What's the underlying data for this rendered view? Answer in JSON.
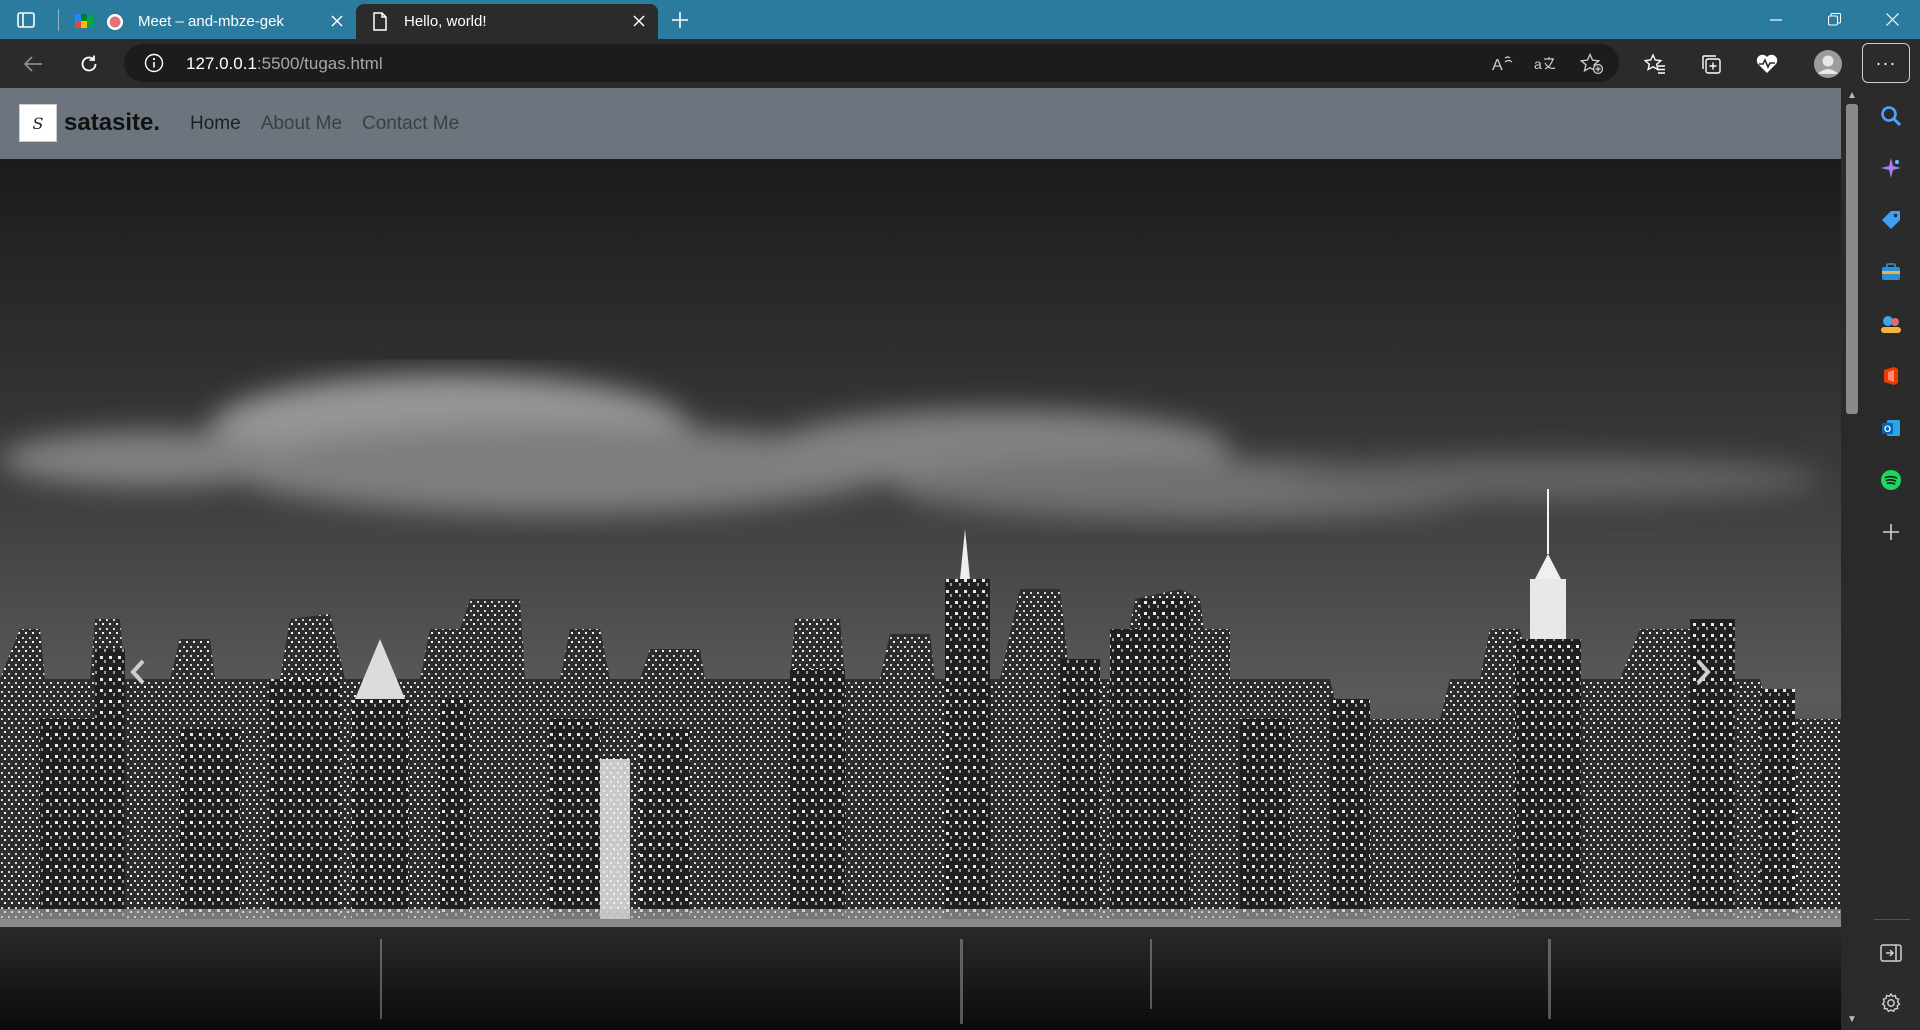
{
  "browser": {
    "tabs": [
      {
        "title": "Meet – and-mbze-gek",
        "active": false
      },
      {
        "title": "Hello, world!",
        "active": true
      }
    ],
    "url_host": "127.0.0.1",
    "url_rest": ":5500/tugas.html",
    "menu_label": "···"
  },
  "site": {
    "brand_mark": "S",
    "brand_name": "satasite.",
    "nav": [
      {
        "label": "Home",
        "active": true
      },
      {
        "label": "About Me",
        "active": false
      },
      {
        "label": "Contact Me",
        "active": false
      }
    ]
  },
  "hero": {
    "description": "",
    "colors": {
      "sky_top": "#1b1b1b",
      "sky_mid": "#5a5a5a",
      "water": "#0c0c0c"
    }
  },
  "icons": {
    "sidebar": [
      "search-icon",
      "copilot-icon",
      "shopping-tag-icon",
      "tools-icon",
      "games-icon",
      "office-icon",
      "outlook-icon",
      "spotify-icon",
      "add-icon",
      "hide-sidebar-icon",
      "settings-icon"
    ]
  },
  "colors": {
    "tabstrip": "#2b7b9e",
    "toolbar": "#2b2b2b",
    "site_nav": "#6c757d"
  }
}
